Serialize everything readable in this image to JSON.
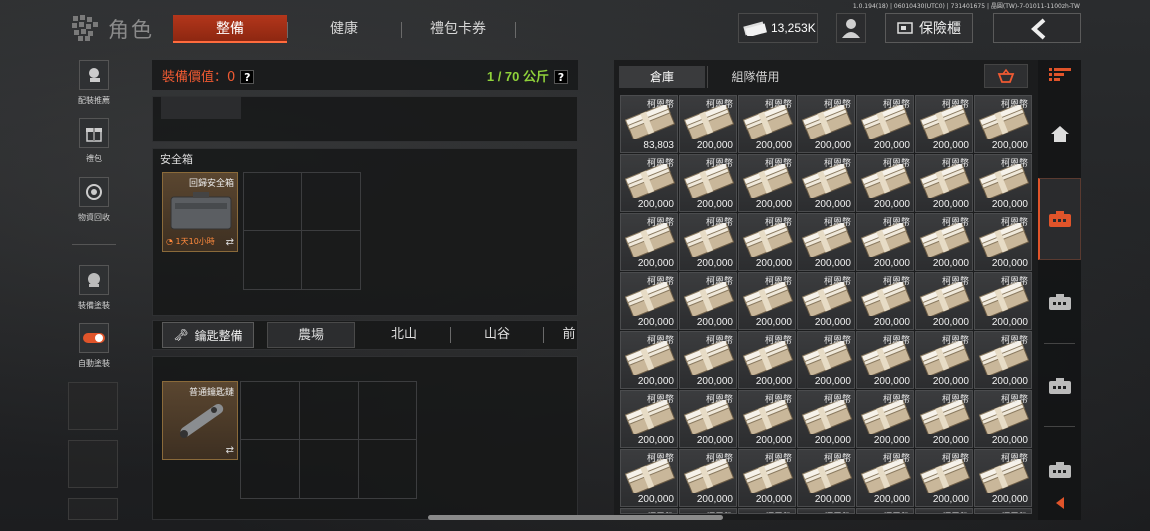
{
  "build_info": "1.0.194(18) | 06010430(UTC0) | 731401675 | 晶圓(TW)-7-01011-1100zh-TW",
  "header": {
    "title": "角色",
    "tabs": [
      {
        "label": "整備",
        "active": true
      },
      {
        "label": "健康",
        "active": false
      },
      {
        "label": "禮包卡券",
        "active": false
      }
    ],
    "money": "13,253K",
    "safe_button": "保險櫃"
  },
  "left_sidebar": {
    "items": [
      {
        "label": "配裝推薦",
        "icon": "loadout-icon"
      },
      {
        "label": "禮包",
        "icon": "gift-icon"
      },
      {
        "label": "物資回收",
        "icon": "recycle-icon"
      },
      {
        "label": "裝備塗裝",
        "icon": "paint-icon"
      },
      {
        "label": "自動塗裝",
        "icon": "toggle-icon"
      }
    ]
  },
  "equipment": {
    "value_label": "裝備價值：0",
    "weight": "1 / 70 公斤",
    "help": "?",
    "safebox_title": "安全箱",
    "safebox_item": {
      "name": "回歸安全箱",
      "timer": "1天10小時"
    },
    "key_button": "鑰匙整備",
    "key_tabs": [
      "農場",
      "北山",
      "山谷",
      "前"
    ],
    "key_item": {
      "name": "普通鑰匙鏈"
    }
  },
  "storage": {
    "tabs": [
      {
        "label": "倉庫",
        "active": true
      },
      {
        "label": "組隊借用",
        "active": false
      }
    ],
    "item_name": "柯恩幣",
    "first_qty": "83,803",
    "qty": "200,000",
    "rows": 7,
    "cols": 7
  },
  "colors": {
    "accent": "#b3361b",
    "value_red": "#f05a32",
    "weight_green": "#8fd13a"
  }
}
